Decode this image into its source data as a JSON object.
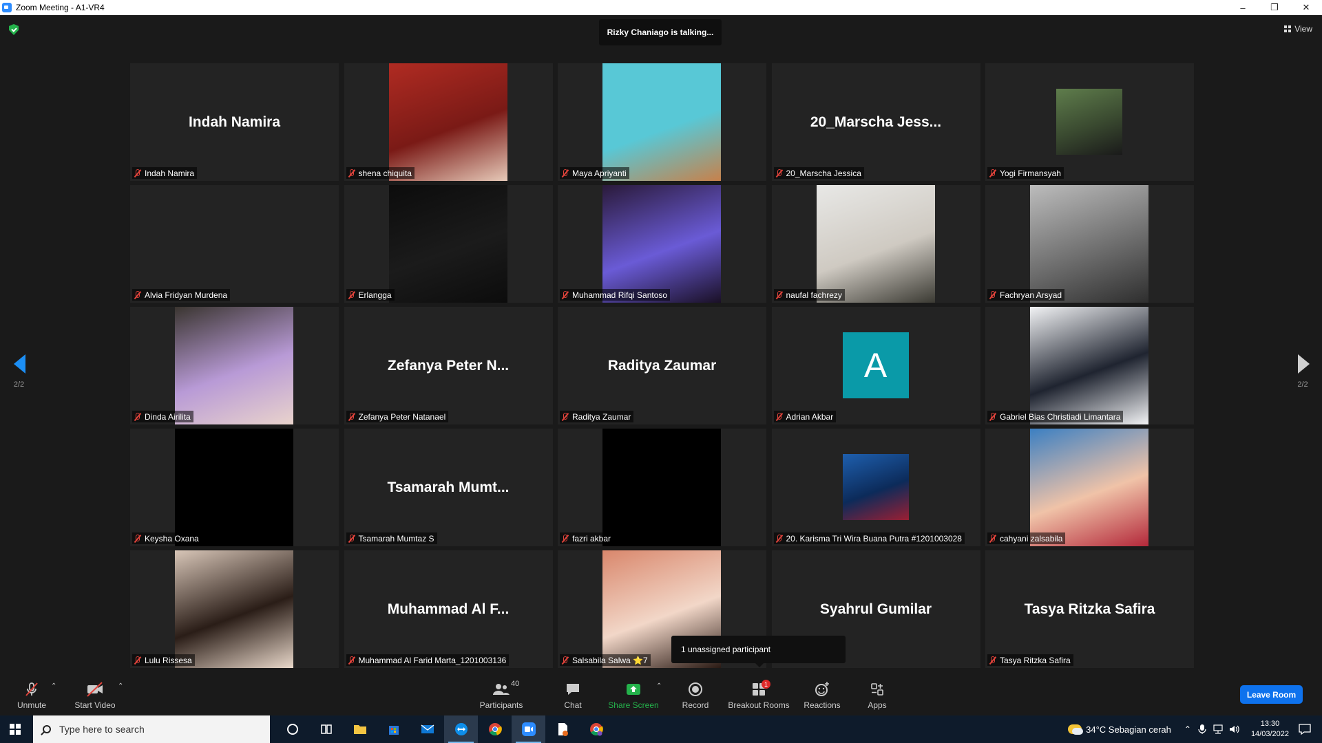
{
  "window": {
    "title": "Zoom Meeting - A1-VR4",
    "minimize": "–",
    "restore": "❐",
    "close": "✕"
  },
  "talking_banner": "Rizky Chaniago is talking...",
  "view_button": "View",
  "page_indicator": {
    "left": "2/2",
    "right": "2/2"
  },
  "tiles": [
    {
      "name": "Indah Namira",
      "display": "Indah Namira",
      "type": "name"
    },
    {
      "name": "shena chiquita",
      "type": "video",
      "colors": [
        "#b02b22",
        "#7a1a16",
        "#e6c9b8"
      ]
    },
    {
      "name": "Maya Apriyanti",
      "type": "video",
      "colors": [
        "#58c8d6",
        "#58c8d6",
        "#c7814b"
      ]
    },
    {
      "name": "20_Marscha Jessica",
      "display": "20_Marscha Jess...",
      "type": "name"
    },
    {
      "name": "Yogi Firmansyah",
      "type": "small",
      "colors": [
        "#5f7d4c",
        "#3a4a30",
        "#1a1a1a"
      ]
    },
    {
      "name": "Alvia Fridyan Murdena",
      "type": "blank"
    },
    {
      "name": "Erlangga",
      "type": "video",
      "colors": [
        "#0c0c0c",
        "#1b1b1b",
        "#0c0c0c"
      ]
    },
    {
      "name": "Muhammad Rifqi Santoso",
      "type": "video",
      "colors": [
        "#2a1a3a",
        "#6a5bd6",
        "#1a1026"
      ]
    },
    {
      "name": "naufal fachrezy",
      "type": "video",
      "colors": [
        "#e8e8e6",
        "#cfcac2",
        "#3b3a33"
      ]
    },
    {
      "name": "Fachryan Arsyad",
      "type": "video",
      "colors": [
        "#bcbcbc",
        "#6f6f6f",
        "#2e2e2e"
      ]
    },
    {
      "name": "Dinda Airilita",
      "type": "video",
      "colors": [
        "#3a3530",
        "#b89ad6",
        "#e9d3cc"
      ]
    },
    {
      "name": "Zefanya Peter Natanael",
      "display": "Zefanya Peter N...",
      "type": "name"
    },
    {
      "name": "Raditya Zaumar",
      "display": "Raditya Zaumar",
      "type": "name"
    },
    {
      "name": "Adrian Akbar",
      "type": "avatar",
      "letter": "A"
    },
    {
      "name": "Gabriel Bias Christiadi Limantara",
      "type": "video",
      "colors": [
        "#f2f3f5",
        "#1f2430",
        "#f2f3f5"
      ]
    },
    {
      "name": "Keysha Oxana",
      "type": "video",
      "colors": [
        "#000000",
        "#000000",
        "#000000"
      ]
    },
    {
      "name": "Tsamarah Mumtaz S",
      "display": "Tsamarah  Mumt...",
      "type": "name"
    },
    {
      "name": "fazri akbar",
      "type": "video",
      "colors": [
        "#000000",
        "#000000",
        "#000000"
      ]
    },
    {
      "name": "20. Karisma Tri Wira Buana Putra #1201003028",
      "type": "small",
      "colors": [
        "#1e5fae",
        "#0c2b5a",
        "#9b1f33"
      ]
    },
    {
      "name": "cahyani zalsabila",
      "type": "video",
      "colors": [
        "#3b7fc2",
        "#f0c3a8",
        "#b3283a"
      ]
    },
    {
      "name": "Lulu Rissesa",
      "type": "video",
      "colors": [
        "#d8c6b8",
        "#2a1d17",
        "#e9d8ca"
      ]
    },
    {
      "name": "Muhammad Al Farid Marta_1201003136",
      "display": "Muhammad  Al  F...",
      "type": "name"
    },
    {
      "name": "Salsabila Salwa  ⭐7",
      "type": "video",
      "colors": [
        "#d9876c",
        "#f2d7c8",
        "#2a1a14"
      ]
    },
    {
      "name": "Syahrul Gumilar",
      "display": "Syahrul Gumilar",
      "type": "name",
      "hide_plate": true
    },
    {
      "name": "Tasya Ritzka Safira",
      "display": "Tasya Ritzka Safira",
      "type": "name"
    }
  ],
  "tooltip": "1 unassigned participant",
  "toolbar": {
    "unmute": "Unmute",
    "start_video": "Start Video",
    "participants": "Participants",
    "participant_count": "40",
    "chat": "Chat",
    "share_screen": "Share Screen",
    "record": "Record",
    "breakout_rooms": "Breakout Rooms",
    "breakout_badge": "1",
    "reactions": "Reactions",
    "apps": "Apps",
    "leave": "Leave Room",
    "colors": {
      "share": "#24b24b",
      "leave": "#0e72ed",
      "muted": "#e0433b"
    }
  },
  "taskbar": {
    "search_placeholder": "Type here to search",
    "apps": [
      "cortana-icon",
      "task-view-icon",
      "file-explorer-icon",
      "store-icon",
      "mail-icon",
      "teamviewer-icon",
      "chrome-icon",
      "zoom-icon",
      "document-icon",
      "chrome-profile-icon"
    ],
    "weather": "34°C  Sebagian cerah",
    "time": "13:30",
    "date": "14/03/2022"
  }
}
